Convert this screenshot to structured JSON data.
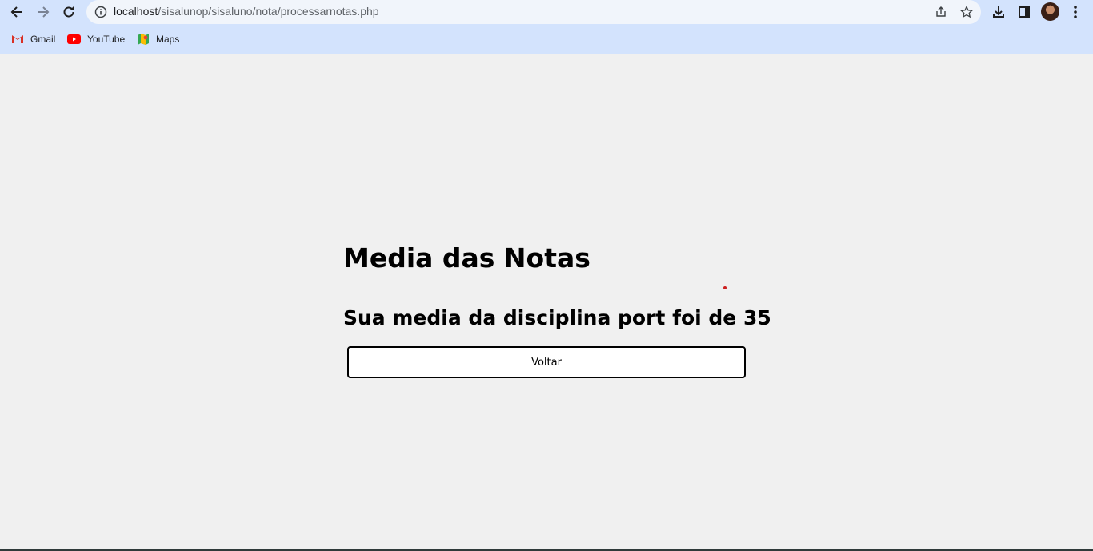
{
  "browser": {
    "url_host": "localhost",
    "url_path": "/sisalunop/sisaluno/nota/processarnotas.php",
    "bookmarks": [
      {
        "label": "Gmail",
        "icon": "gmail-icon"
      },
      {
        "label": "YouTube",
        "icon": "youtube-icon"
      },
      {
        "label": "Maps",
        "icon": "maps-icon"
      }
    ]
  },
  "page": {
    "title": "Media das Notas",
    "result_text": "Sua media da disciplina port foi de 35",
    "back_button_label": "Voltar"
  },
  "colors": {
    "toolbar_bg": "#d3e3fd",
    "page_bg": "#f0f0f0",
    "button_border": "#000000"
  }
}
